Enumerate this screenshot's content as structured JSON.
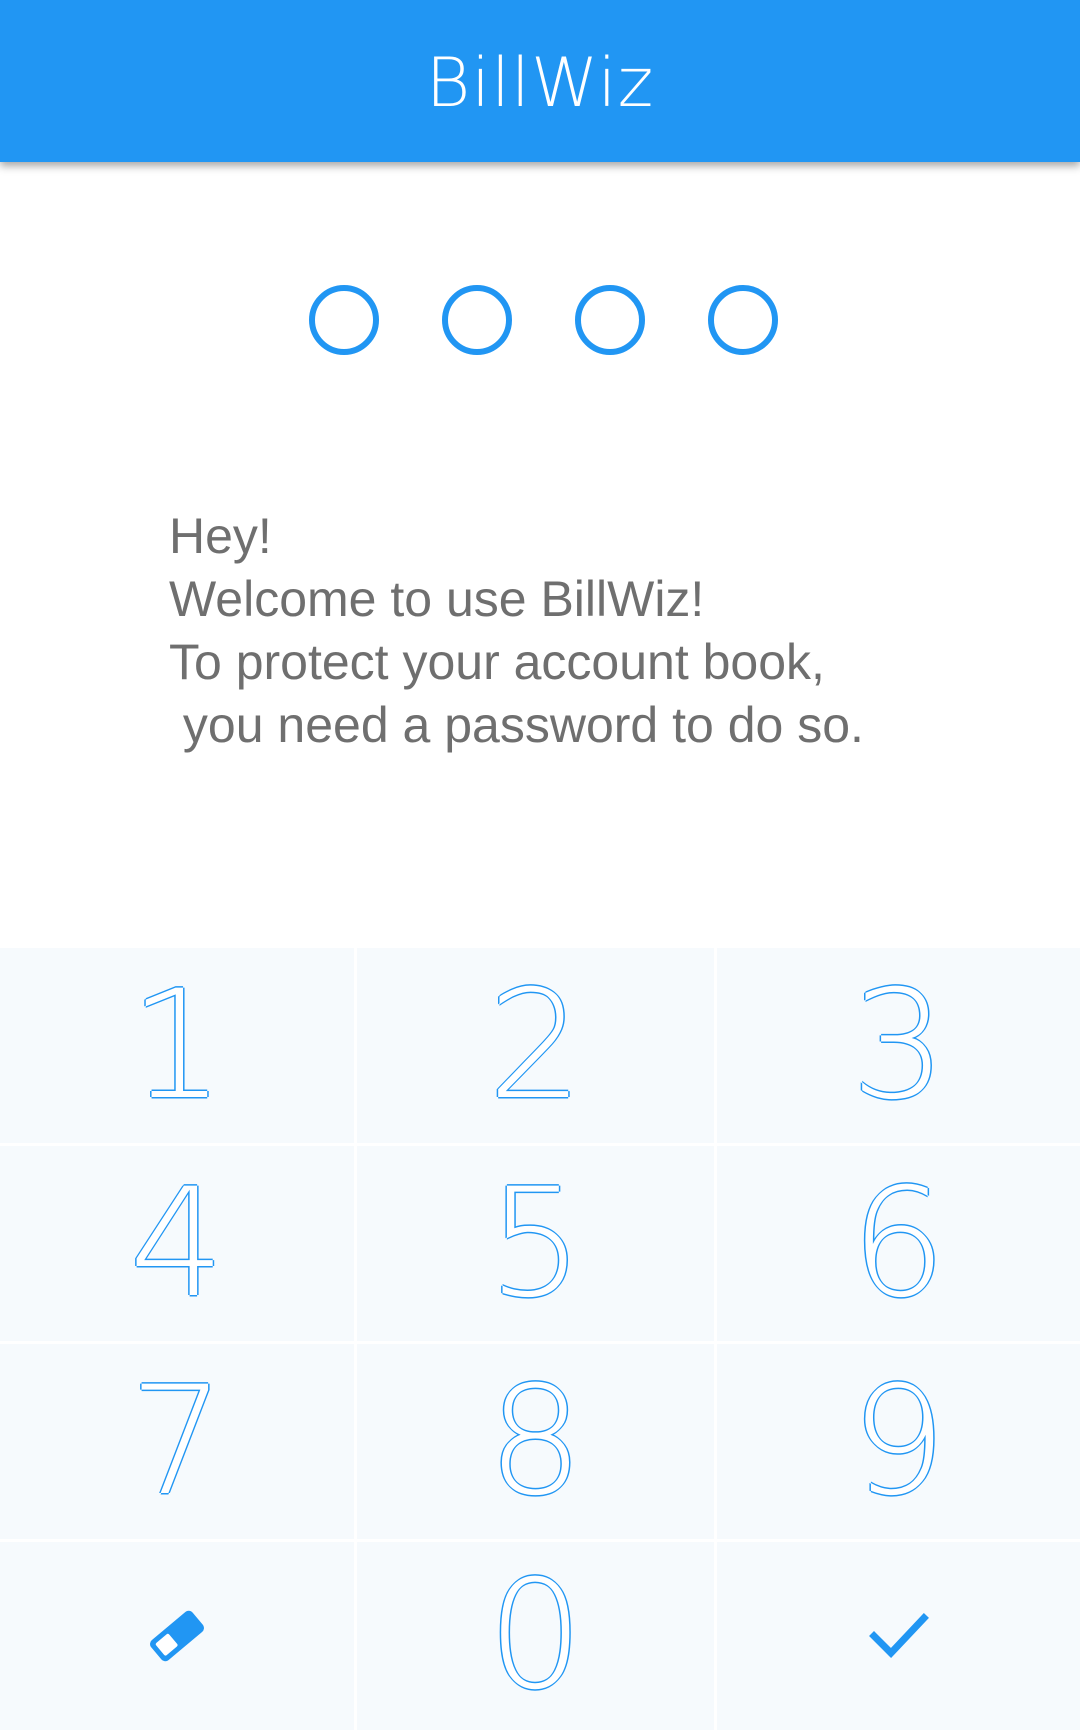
{
  "app_bar": {
    "title": "BillWiz"
  },
  "pin": {
    "length": 4,
    "filled": 0
  },
  "message": {
    "lines": [
      "Hey!",
      "Welcome to use BillWiz!",
      "To protect your account book,",
      " you need a password to do so."
    ]
  },
  "keypad": {
    "keys": [
      "1",
      "2",
      "3",
      "4",
      "5",
      "6",
      "7",
      "8",
      "9",
      "0"
    ],
    "erase_icon": "eraser-icon",
    "confirm_icon": "check-icon"
  },
  "colors": {
    "accent": "#2196F3",
    "text": "#6f6f6f",
    "key_background": "#f6fafd"
  }
}
